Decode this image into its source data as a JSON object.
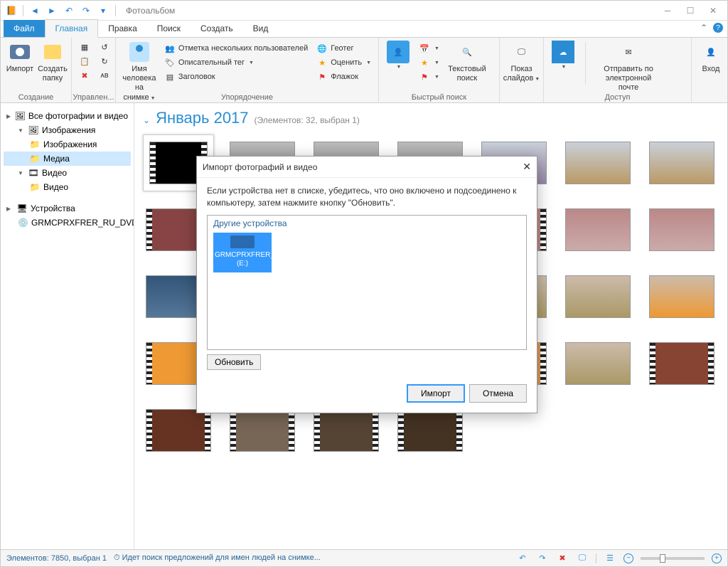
{
  "titlebar": {
    "app_name": "Фотоальбом"
  },
  "tabs": {
    "file": "Файл",
    "main": "Главная",
    "edit": "Правка",
    "find": "Поиск",
    "create": "Создать",
    "view": "Вид"
  },
  "ribbon": {
    "groups": {
      "creation": "Создание",
      "manage": "Управлен...",
      "organize": "Упорядочение",
      "quicksearch": "Быстрый поиск",
      "access": "Доступ"
    },
    "import": "Импорт",
    "create_folder": "Создать папку",
    "person_on_photo": "Имя человека на снимке",
    "tag_users": "Отметка нескольких пользователей",
    "geotag": "Геотег",
    "descriptive_tag": "Описательный тег",
    "rate": "Оценить",
    "title": "Заголовок",
    "flag": "Флажок",
    "text_search": "Текстовый поиск",
    "slideshow": "Показ слайдов",
    "email": "Отправить по электронной почте",
    "login": "Вход"
  },
  "sidebar": {
    "all": "Все фотографии и видео",
    "images": "Изображения",
    "images_sub": "Изображения",
    "media": "Медиа",
    "videos": "Видео",
    "videos_sub": "Видео",
    "devices": "Устройства",
    "dvd": "GRMCPRXFRER_RU_DVD"
  },
  "contentHeader": {
    "title": "Январь 2017",
    "meta": "(Элементов: 32, выбран 1)"
  },
  "dialog": {
    "title": "Импорт фотографий и видео",
    "msg": "Если устройства нет в списке, убедитесь, что оно включено и подсоединено к компьютеру, затем нажмите кнопку \"Обновить\".",
    "other_devices": "Другие устройства",
    "device_name": "GRMCPRXFRER_RU_DVD (E:)",
    "refresh": "Обновить",
    "import": "Импорт",
    "cancel": "Отмена"
  },
  "status": {
    "items": "Элементов: 7850, выбран 1",
    "searching": "Идет поиск предложений для имен людей на снимке..."
  }
}
